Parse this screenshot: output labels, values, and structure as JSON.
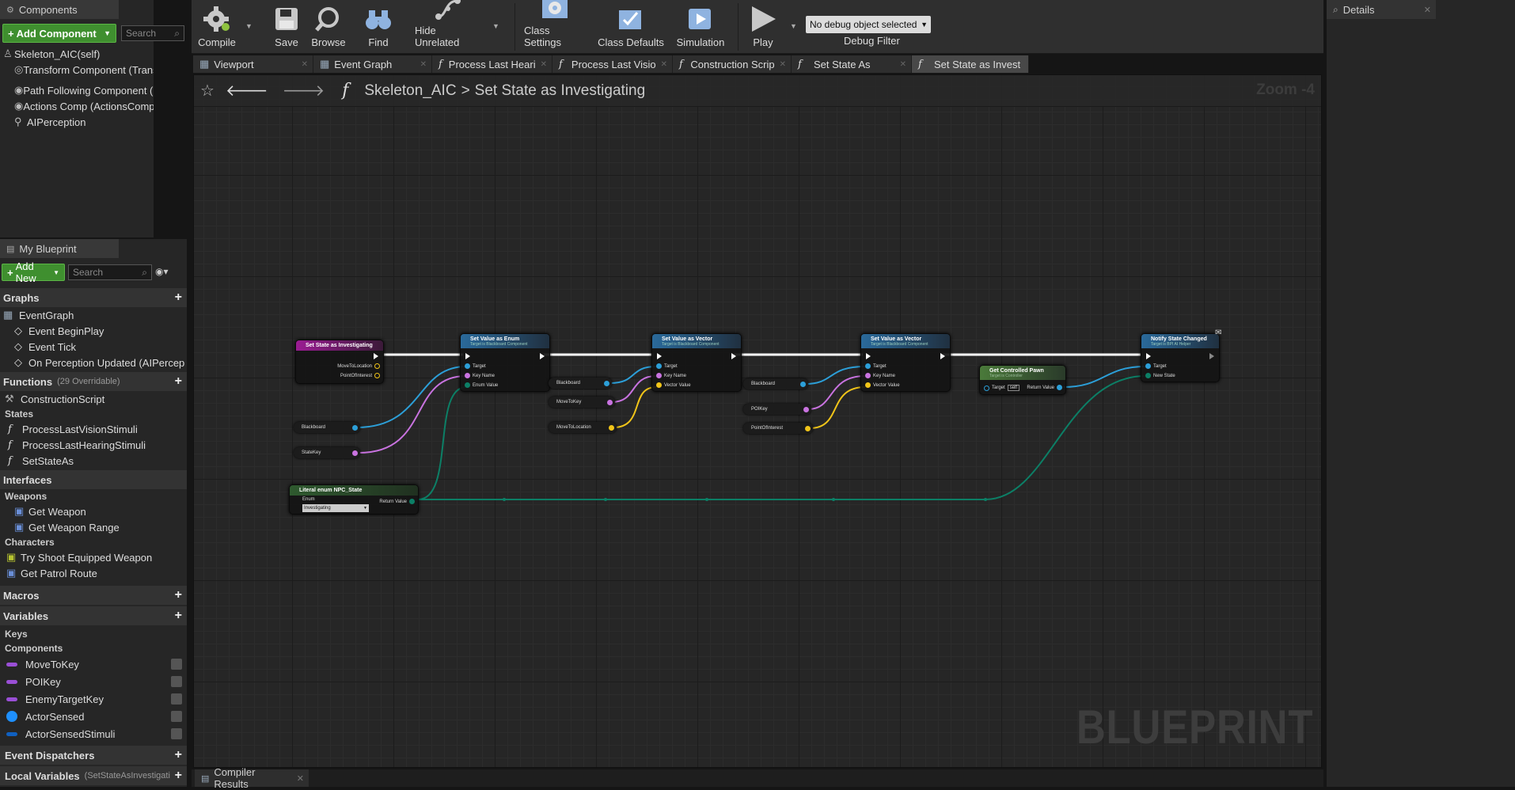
{
  "components_panel": {
    "title": "Components",
    "add_component": "Add Component",
    "search_placeholder": "Search",
    "items": [
      "Skeleton_AIC(self)",
      "Transform Component (TransformCo",
      "Path Following Component (PathFo",
      "Actions Comp (ActionsComp) (Inheri",
      "AIPerception"
    ]
  },
  "toolbar": {
    "compile": "Compile",
    "save": "Save",
    "browse": "Browse",
    "find": "Find",
    "hide_unrelated": "Hide Unrelated",
    "class_settings": "Class Settings",
    "class_defaults": "Class Defaults",
    "simulation": "Simulation",
    "play": "Play",
    "debug_object": "No debug object selected",
    "debug_filter": "Debug Filter"
  },
  "details_panel": {
    "title": "Details"
  },
  "doc_tabs": [
    "Viewport",
    "Event Graph",
    "Process Last Heari",
    "Process Last Visio",
    "Construction Scrip",
    "Set State As",
    "Set State as Invest"
  ],
  "breadcrumb": {
    "root": "Skeleton_AIC",
    "separator": ">",
    "current": "Set State as Investigating",
    "zoom": "Zoom -4"
  },
  "watermark": "BLUEPRINT",
  "my_blueprint": {
    "title": "My Blueprint",
    "add_new": "Add New",
    "search_placeholder": "Search",
    "graphs_label": "Graphs",
    "event_graph": "EventGraph",
    "events": [
      "Event BeginPlay",
      "Event Tick",
      "On Perception Updated (AIPercep"
    ],
    "functions_label": "Functions",
    "functions_count": "(29 Overridable)",
    "construction_script": "ConstructionScript",
    "states_label": "States",
    "state_functions": [
      "ProcessLastVisionStimuli",
      "ProcessLastHearingStimuli",
      "SetStateAs"
    ],
    "interfaces_label": "Interfaces",
    "weapons_label": "Weapons",
    "weapons": [
      "Get Weapon",
      "Get Weapon Range"
    ],
    "characters_label": "Characters",
    "characters": [
      "Try Shoot Equipped Weapon",
      "Get Patrol Route"
    ],
    "macros_label": "Macros",
    "variables_label": "Variables",
    "keys_label": "Keys",
    "components_label": "Components",
    "variables": [
      {
        "name": "MoveToKey",
        "color": "#9a4fd6"
      },
      {
        "name": "POIKey",
        "color": "#9a4fd6"
      },
      {
        "name": "EnemyTargetKey",
        "color": "#9a4fd6"
      },
      {
        "name": "ActorSensed",
        "color": "#1e90ff"
      },
      {
        "name": "ActorSensedStimuli",
        "color": "#1060c0"
      }
    ],
    "event_dispatchers_label": "Event Dispatchers",
    "local_variables_label": "Local Variables",
    "local_variables_scope": "(SetStateAsInvestigati"
  },
  "compiler_results": "Compiler Results",
  "graph": {
    "entry": {
      "title": "Set State as Investigating",
      "outputs": [
        "MoveToLocation",
        "PointOfInterest"
      ]
    },
    "set_enum": {
      "title": "Set Value as Enum",
      "subtitle": "Target is Blackboard Component",
      "inputs": [
        "Target",
        "Key Name",
        "Enum Value"
      ]
    },
    "set_vec1": {
      "title": "Set Value as Vector",
      "subtitle": "Target is Blackboard Component",
      "inputs": [
        "Target",
        "Key Name",
        "Vector Value"
      ]
    },
    "set_vec2": {
      "title": "Set Value as Vector",
      "subtitle": "Target is Blackboard Component",
      "inputs": [
        "Target",
        "Key Name",
        "Vector Value"
      ]
    },
    "get_pawn": {
      "title": "Get Controlled Pawn",
      "subtitle": "Target is Controller",
      "target": "Target",
      "self": "self",
      "ret": "Return Value"
    },
    "notify": {
      "title": "Notify State Changed",
      "subtitle": "Target is BPI AI Helper",
      "inputs": [
        "Target",
        "New State"
      ]
    },
    "literal": {
      "title": "Literal enum NPC_State",
      "enum": "Enum",
      "ret": "Return Value",
      "value": "Investigating"
    },
    "vars": {
      "bb1": "Blackboard",
      "statekey": "StateKey",
      "bb2": "Blackboard",
      "movetokey": "MoveToKey",
      "movetoloc": "MoveToLocation",
      "bb3": "Blackboard",
      "poikey": "POIKey",
      "poi": "PointOfInterest"
    }
  }
}
